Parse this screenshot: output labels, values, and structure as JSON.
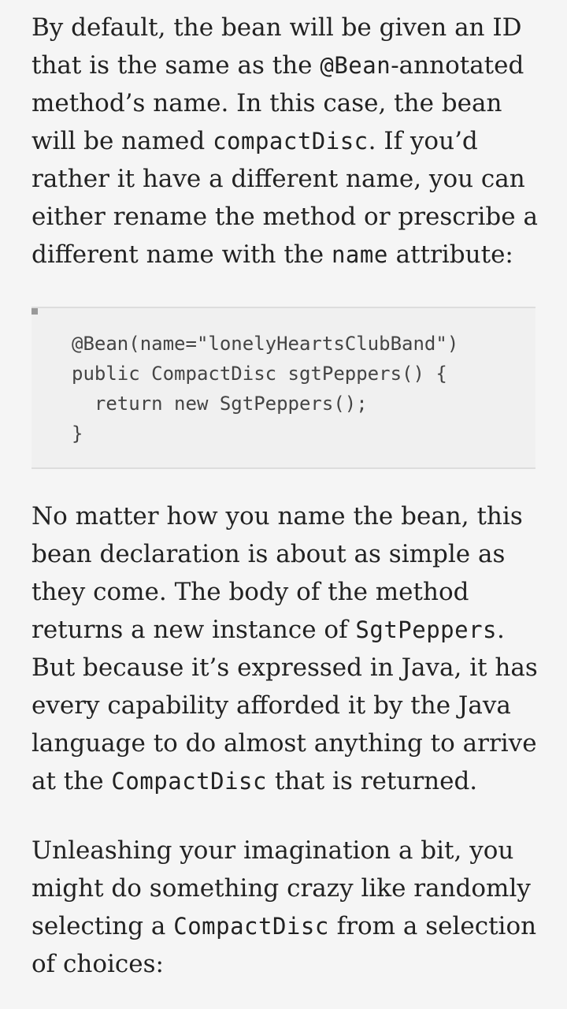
{
  "paragraph1": {
    "t1": "By default, the bean will be given an ID that is the same as the ",
    "c1": "@Bean",
    "t2": "-annotated method’s name. In this case, the bean will be named ",
    "c2": "compactDisc",
    "t3": ". If you’d rather it have a different name, you can either rename the method or prescribe a different name with the ",
    "c3": "name",
    "t4": " attribute:"
  },
  "code_block": {
    "lines": [
      "@Bean(name=\"lonelyHeartsClubBand\")",
      "public CompactDisc sgtPeppers() {",
      "  return new SgtPeppers();",
      "}"
    ]
  },
  "paragraph2": {
    "t1": "No matter how you name the bean, this bean declaration is about as simple as they come. The body of the method returns a new instance of ",
    "c1": "SgtPeppers",
    "t2": ". But because it’s expressed in Java, it has every capability afforded it by the Java language to do almost anything to arrive at the ",
    "c2": "CompactDisc",
    "t3": " that is returned."
  },
  "paragraph3": {
    "t1": "Unleashing your imagination a bit, you might do something crazy like randomly selecting a ",
    "c1": "CompactDisc",
    "t2": " from a selection of choices:"
  }
}
